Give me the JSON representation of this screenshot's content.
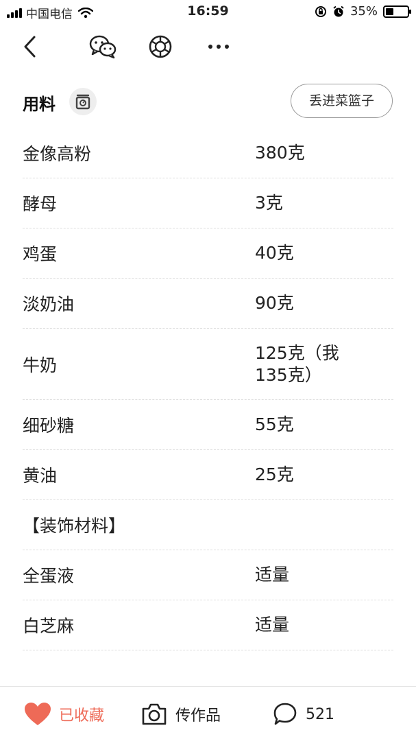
{
  "status_bar": {
    "carrier": "中国电信",
    "time": "16:59",
    "battery_percent": "35%",
    "battery_level": 0.35,
    "icons": [
      "signal-icon",
      "wifi-icon",
      "rotation-lock-icon",
      "alarm-icon",
      "battery-icon"
    ]
  },
  "nav": {
    "icons": [
      "back-icon",
      "wechat-icon",
      "moments-icon",
      "more-icon"
    ]
  },
  "section": {
    "title": "用料",
    "scale_icon": "scale-icon",
    "basket_button": "丢进菜篮子"
  },
  "ingredients": [
    {
      "name": "金像高粉",
      "amount": "380克"
    },
    {
      "name": "酵母",
      "amount": "3克"
    },
    {
      "name": "鸡蛋",
      "amount": "40克"
    },
    {
      "name": "淡奶油",
      "amount": "90克"
    },
    {
      "name": "牛奶",
      "amount": "125克（我135克）"
    },
    {
      "name": "细砂糖",
      "amount": "55克"
    },
    {
      "name": "黄油",
      "amount": "25克"
    },
    {
      "name": "【装饰材料】",
      "amount": ""
    },
    {
      "name": "全蛋液",
      "amount": "适量"
    },
    {
      "name": "白芝麻",
      "amount": "适量"
    }
  ],
  "bottom_bar": {
    "favorite_label": "已收藏",
    "upload_label": "传作品",
    "comment_count": "521",
    "accent_color": "#ee6a57"
  }
}
